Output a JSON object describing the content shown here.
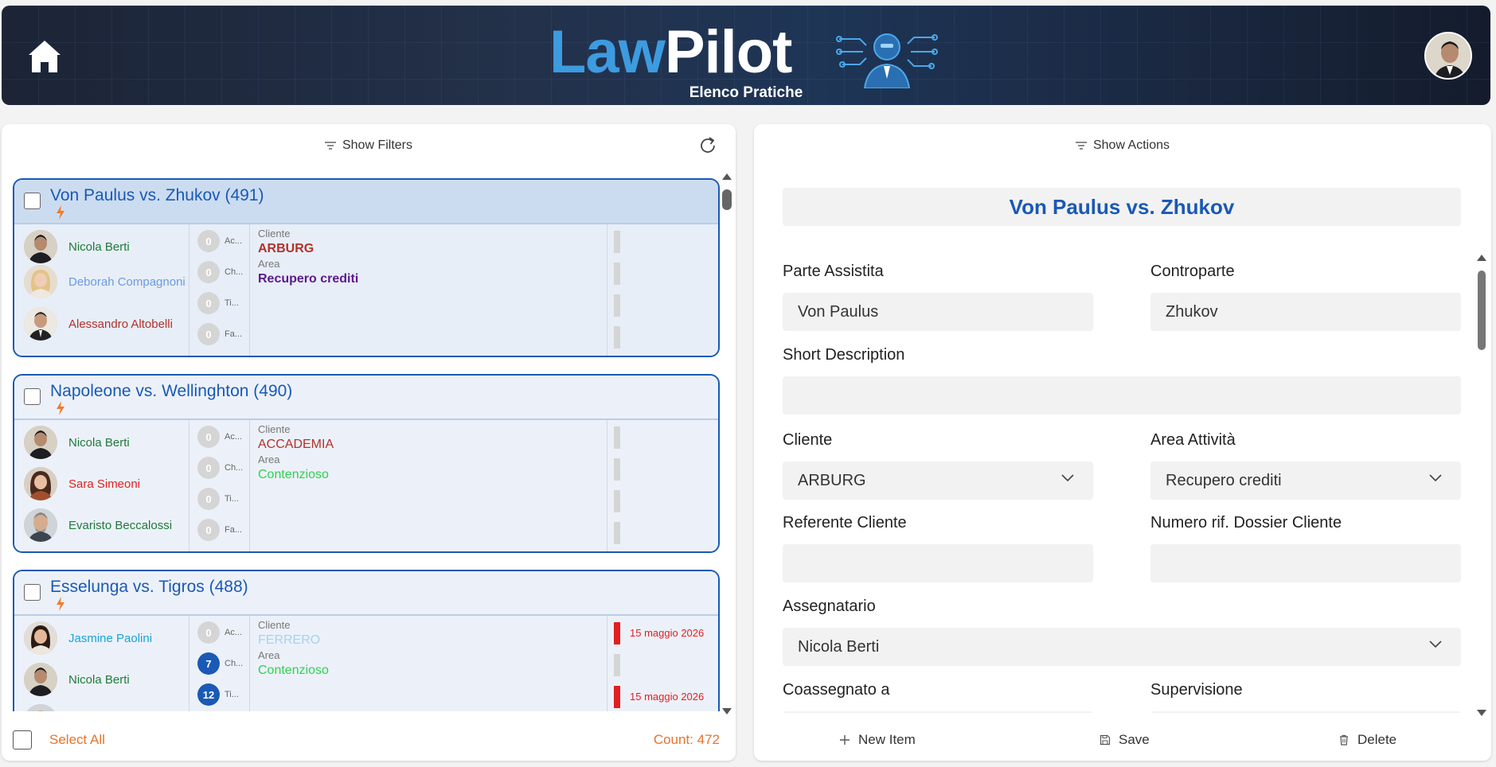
{
  "header": {
    "logo_part1": "Law",
    "logo_part2": "Pilot",
    "subtitle": "Elenco Pratiche"
  },
  "left": {
    "show_filters": "Show Filters",
    "select_all": "Select All",
    "count": "Count: 472",
    "cards": [
      {
        "title": "Von Paulus vs. Zhukov (491)",
        "people": [
          {
            "name": "Nicola Berti",
            "color": "#1f7a3a"
          },
          {
            "name": "Deborah Compagnoni",
            "color": "#6a9be0"
          },
          {
            "name": "Alessandro Altobelli",
            "color": "#b3312a"
          }
        ],
        "counters": [
          {
            "value": "0",
            "label": "Ac..."
          },
          {
            "value": "0",
            "label": "Ch..."
          },
          {
            "value": "0",
            "label": "Ti..."
          },
          {
            "value": "0",
            "label": "Fa..."
          }
        ],
        "cliente_caption": "Cliente",
        "cliente": "ARBURG",
        "cliente_color": "#b3312a",
        "area_caption": "Area",
        "area": "Recupero crediti",
        "area_color": "#5a1a8a",
        "dates": [
          "",
          "",
          "",
          ""
        ]
      },
      {
        "title": "Napoleone vs. Wellinghton (490)",
        "people": [
          {
            "name": "Nicola Berti",
            "color": "#1f7a3a"
          },
          {
            "name": "Sara Simeoni",
            "color": "#e41e1e"
          },
          {
            "name": "Evaristo Beccalossi",
            "color": "#1f7a3a"
          }
        ],
        "counters": [
          {
            "value": "0",
            "label": "Ac..."
          },
          {
            "value": "0",
            "label": "Ch..."
          },
          {
            "value": "0",
            "label": "Ti..."
          },
          {
            "value": "0",
            "label": "Fa..."
          }
        ],
        "cliente_caption": "Cliente",
        "cliente": "ACCADEMIA",
        "cliente_color": "#b3312a",
        "area_caption": "Area",
        "area": "Contenzioso",
        "area_color": "#2fd14f",
        "dates": [
          "",
          "",
          "",
          ""
        ]
      },
      {
        "title": "Esselunga vs. Tigros (488)",
        "people": [
          {
            "name": "Jasmine Paolini",
            "color": "#1aa3d9"
          },
          {
            "name": "Nicola Berti",
            "color": "#1f7a3a"
          },
          {
            "name": "",
            "color": "#1f7a3a"
          }
        ],
        "counters": [
          {
            "value": "0",
            "label": "Ac..."
          },
          {
            "value": "7",
            "label": "Ch..."
          },
          {
            "value": "12",
            "label": "Ti..."
          },
          {
            "value": "",
            "label": ""
          }
        ],
        "cliente_caption": "Cliente",
        "cliente": "FERRERO",
        "cliente_color": "#a5d2ef",
        "area_caption": "Area",
        "area": "Contenzioso",
        "area_color": "#2fd14f",
        "dates": [
          "15 maggio 2026",
          "",
          "15 maggio 2026",
          ""
        ]
      }
    ]
  },
  "right": {
    "show_actions": "Show Actions",
    "title": "Von Paulus vs. Zhukov",
    "fields": {
      "parte_assistita_label": "Parte Assistita",
      "parte_assistita": "Von Paulus",
      "controparte_label": "Controparte",
      "controparte": "Zhukov",
      "short_desc_label": "Short Description",
      "short_desc": "",
      "cliente_label": "Cliente",
      "cliente": "ARBURG",
      "area_label": "Area Attività",
      "area": "Recupero crediti",
      "referente_label": "Referente Cliente",
      "referente": "",
      "numero_label": "Numero rif. Dossier Cliente",
      "numero": "",
      "assegnatario_label": "Assegnatario",
      "assegnatario": "Nicola Berti",
      "coassegnato_label": "Coassegnato a",
      "supervisione_label": "Supervisione"
    },
    "actions": {
      "new_item": "New Item",
      "save": "Save",
      "delete": "Delete"
    }
  }
}
